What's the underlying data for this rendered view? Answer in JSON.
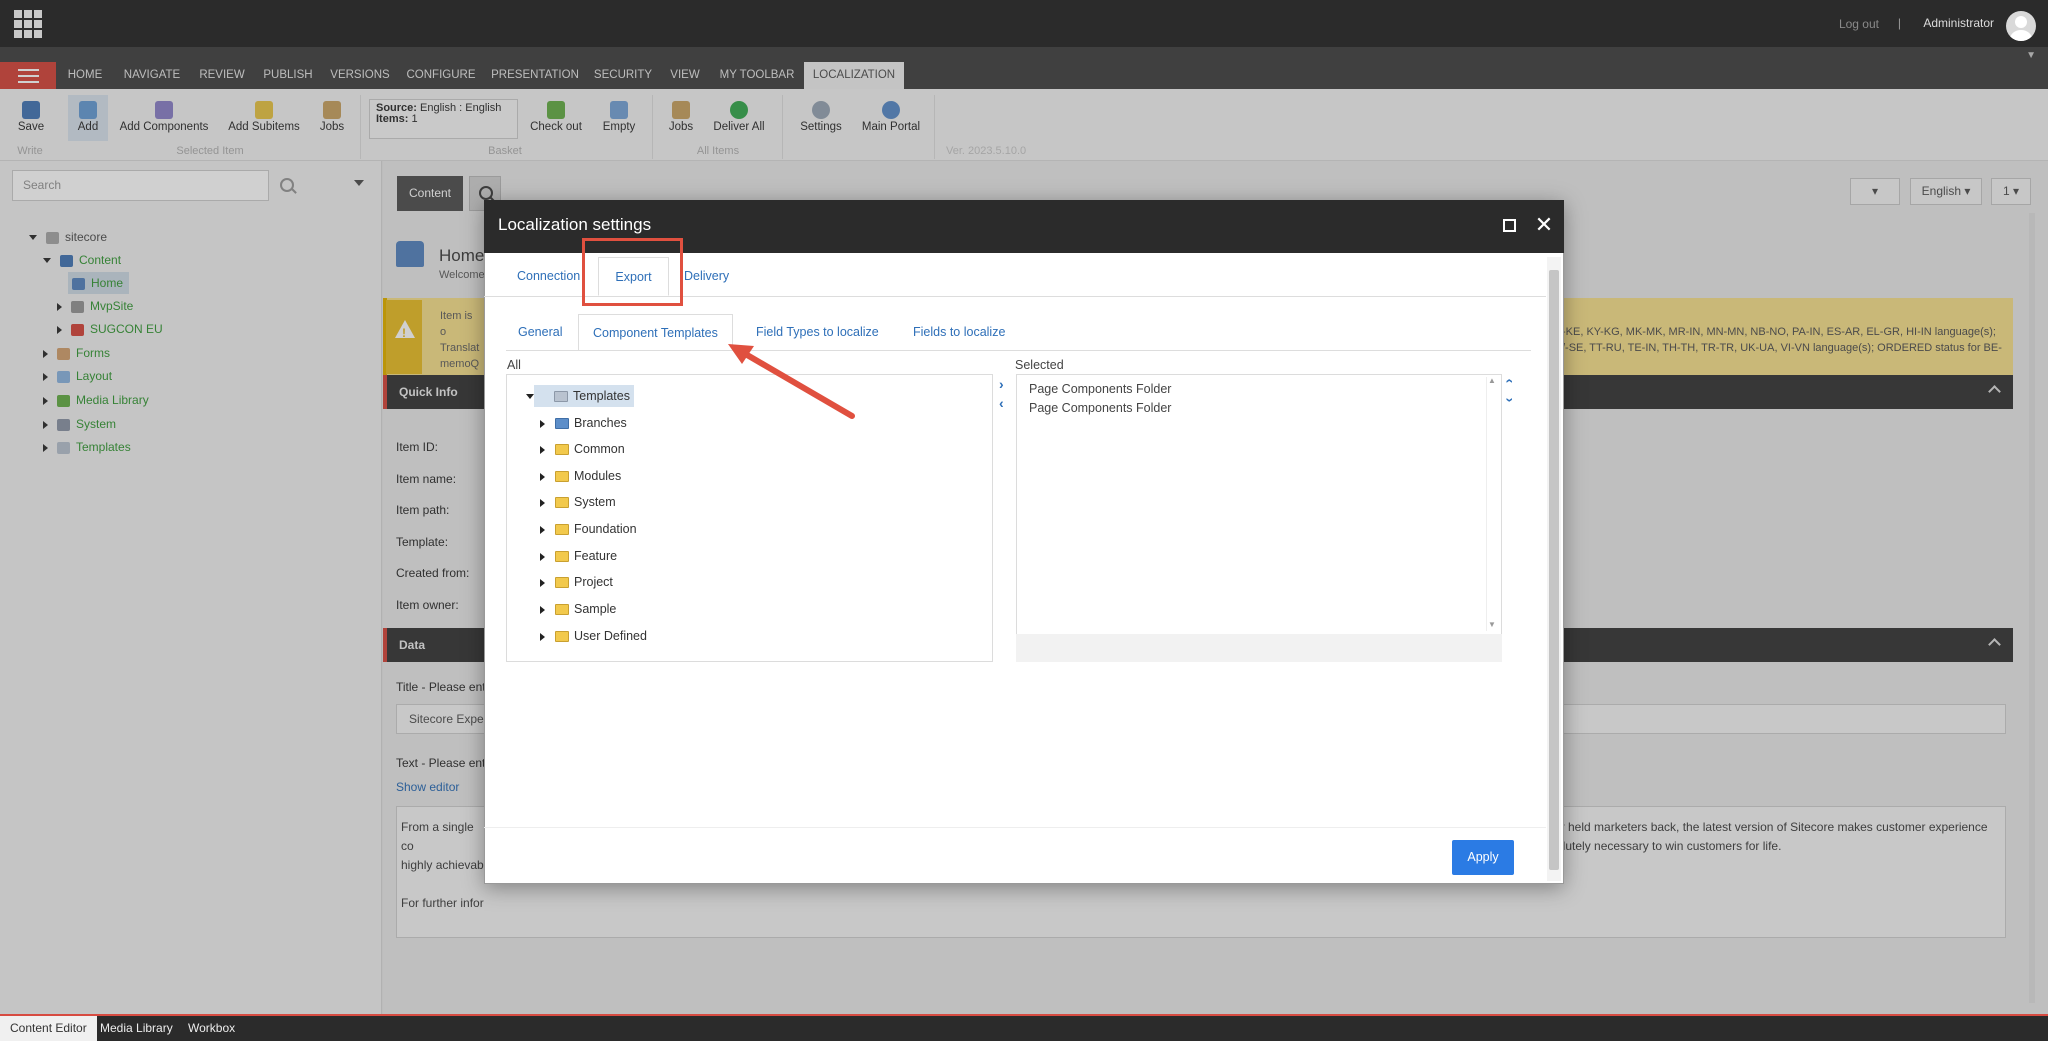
{
  "header": {
    "logout": "Log out",
    "separator": "|",
    "user": "Administrator"
  },
  "ribbon_tabs": [
    "HOME",
    "NAVIGATE",
    "REVIEW",
    "PUBLISH",
    "VERSIONS",
    "CONFIGURE",
    "PRESENTATION",
    "SECURITY",
    "VIEW",
    "MY TOOLBAR",
    "LOCALIZATION"
  ],
  "ribbon": {
    "save": "Save",
    "add": "Add",
    "add_components": "Add Components",
    "add_subitems": "Add Subitems",
    "jobs1": "Jobs",
    "source_label": "Source:",
    "source_value": "English : English",
    "items_label": "Items:",
    "items_value": "1",
    "checkout": "Check out",
    "empty": "Empty",
    "jobs2": "Jobs",
    "deliver_all": "Deliver All",
    "settings": "Settings",
    "main_portal": "Main Portal",
    "group_write": "Write",
    "group_selected": "Selected Item",
    "group_basket": "Basket",
    "group_all": "All Items",
    "version": "Ver. 2023.5.10.0"
  },
  "search": {
    "placeholder": "Search"
  },
  "content_tree": [
    {
      "label": "sitecore",
      "color": "#555"
    },
    {
      "label": "Content",
      "color": "#3a9c3a"
    },
    {
      "label": "Home",
      "color": "#3a9c3a"
    },
    {
      "label": "MvpSite",
      "color": "#3a9c3a"
    },
    {
      "label": "SUGCON EU",
      "color": "#3a9c3a"
    },
    {
      "label": "Forms",
      "color": "#3a9c3a"
    },
    {
      "label": "Layout",
      "color": "#3a9c3a"
    },
    {
      "label": "Media Library",
      "color": "#3a9c3a"
    },
    {
      "label": "System",
      "color": "#3a9c3a"
    },
    {
      "label": "Templates",
      "color": "#3a9c3a"
    }
  ],
  "editor": {
    "tab_content": "Content",
    "lang": "English",
    "version": "1",
    "title": "Home",
    "subtitle": "Welcome",
    "warn_left": "Item is o\nTranslat\nmemoQ\nBY, ZH-C",
    "warn_right": "-KE, KY-KG, MK-MK, MR-IN, MN-MN, NB-NO, PA-IN, ES-AR, EL-GR, HI-IN language(s);\n/-SE, TT-RU, TE-IN, TH-TH, TR-TR, UK-UA, VI-VN language(s); ORDERED status for BE-",
    "quickinfo": "Quick Info",
    "item_id": "Item ID:",
    "item_name": "Item name:",
    "item_path": "Item path:",
    "template": "Template:",
    "created_from": "Created from:",
    "item_owner": "Item owner:",
    "data": "Data",
    "title_label": "Title - Please ente",
    "title_value": "Sitecore Experi",
    "text_label": "Text - Please ente",
    "show_editor": "Show editor",
    "rich_left": "From a single co\nhighly achievabl\n\nFor further infor",
    "rich_right": "ly held marketers back, the latest version of Sitecore makes customer experience\nolutely necessary to win customers for life."
  },
  "dialog": {
    "title": "Localization settings",
    "tabs": [
      "Connection",
      "Export",
      "Delivery"
    ],
    "subtabs": [
      "General",
      "Component Templates",
      "Field Types to localize",
      "Fields to localize"
    ],
    "all_label": "All",
    "selected_label": "Selected",
    "root": "Templates",
    "tree": [
      "Branches",
      "Common",
      "Modules",
      "System",
      "Foundation",
      "Feature",
      "Project",
      "Sample",
      "User Defined"
    ],
    "selected": [
      "Page Components Folder",
      "Page Components Folder"
    ],
    "apply": "Apply"
  },
  "bottom_tabs": [
    "Content Editor",
    "Media Library",
    "Workbox"
  ],
  "colors": {
    "accent": "#d74b41",
    "link": "#2e6fb8",
    "apply": "#2b7be4",
    "annotation": "#e0503f"
  }
}
